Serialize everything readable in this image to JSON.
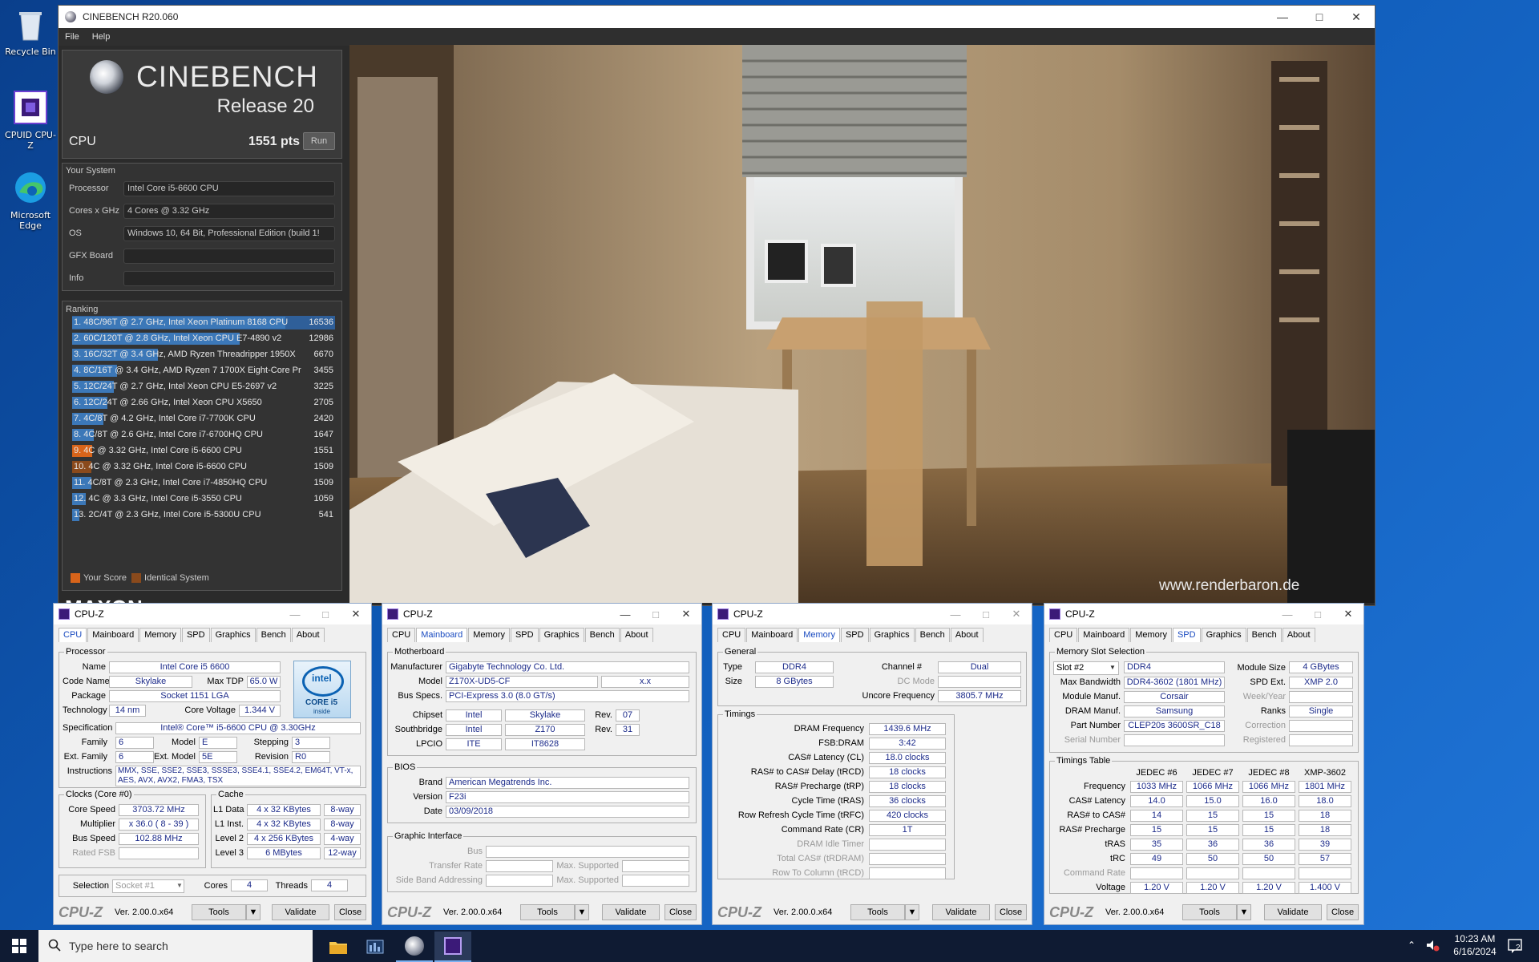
{
  "desktop": {
    "icons": [
      {
        "label": "Recycle Bin"
      },
      {
        "label": "CPUID CPU-Z"
      },
      {
        "label": "Microsoft Edge"
      }
    ]
  },
  "cinebench": {
    "window_title": "CINEBENCH R20.060",
    "menu": [
      "File",
      "Help"
    ],
    "brand": "CINEBENCH",
    "release": "Release 20",
    "cpu_label": "CPU",
    "cpu_score": "1551 pts",
    "run_label": "Run",
    "system_title": "Your System",
    "system": [
      {
        "label": "Processor",
        "value": "Intel Core i5-6600 CPU"
      },
      {
        "label": "Cores x GHz",
        "value": "4 Cores @ 3.32 GHz"
      },
      {
        "label": "OS",
        "value": "Windows 10, 64 Bit, Professional Edition (build 1!"
      },
      {
        "label": "GFX Board",
        "value": ""
      },
      {
        "label": "Info",
        "value": ""
      }
    ],
    "ranking_title": "Ranking",
    "ranking": [
      {
        "text": "1. 48C/96T @ 2.7 GHz, Intel Xeon Platinum 8168 CPU",
        "score": "16536",
        "fraction": 1.0,
        "kind": "other",
        "selected": true
      },
      {
        "text": "2. 60C/120T @ 2.8 GHz, Intel Xeon CPU E7-4890 v2",
        "score": "12986",
        "fraction": 0.785,
        "kind": "other"
      },
      {
        "text": "3. 16C/32T @ 3.4 GHz, AMD Ryzen Threadripper 1950X",
        "score": "6670",
        "fraction": 0.403,
        "kind": "other"
      },
      {
        "text": "4. 8C/16T @ 3.4 GHz, AMD Ryzen 7 1700X Eight-Core Pr",
        "score": "3455",
        "fraction": 0.209,
        "kind": "other"
      },
      {
        "text": "5. 12C/24T @ 2.7 GHz, Intel Xeon CPU E5-2697 v2",
        "score": "3225",
        "fraction": 0.195,
        "kind": "other"
      },
      {
        "text": "6. 12C/24T @ 2.66 GHz, Intel Xeon CPU X5650",
        "score": "2705",
        "fraction": 0.164,
        "kind": "other"
      },
      {
        "text": "7. 4C/8T @ 4.2 GHz, Intel Core i7-7700K CPU",
        "score": "2420",
        "fraction": 0.146,
        "kind": "other"
      },
      {
        "text": "8. 4C/8T @ 2.6 GHz, Intel Core i7-6700HQ CPU",
        "score": "1647",
        "fraction": 0.1,
        "kind": "other"
      },
      {
        "text": "9. 4C @ 3.32 GHz, Intel Core i5-6600 CPU",
        "score": "1551",
        "fraction": 0.094,
        "kind": "yours"
      },
      {
        "text": "10. 4C @ 3.32 GHz, Intel Core i5-6600 CPU",
        "score": "1509",
        "fraction": 0.091,
        "kind": "identical"
      },
      {
        "text": "11. 4C/8T @ 2.3 GHz, Intel Core i7-4850HQ CPU",
        "score": "1509",
        "fraction": 0.091,
        "kind": "other"
      },
      {
        "text": "12. 4C @ 3.3 GHz, Intel Core i5-3550 CPU",
        "score": "1059",
        "fraction": 0.064,
        "kind": "other"
      },
      {
        "text": "13. 2C/4T @ 2.3 GHz, Intel Core i5-5300U CPU",
        "score": "541",
        "fraction": 0.033,
        "kind": "other"
      }
    ],
    "legend": [
      {
        "label": "Your Score",
        "color": "#d8641a"
      },
      {
        "label": "Identical System",
        "color": "#8a4a1c"
      }
    ],
    "maxon_partial": "MAXON",
    "watermark": "www.renderbaron.de"
  },
  "cpuz_common": {
    "title": "CPU-Z",
    "tabs": [
      "CPU",
      "Mainboard",
      "Memory",
      "SPD",
      "Graphics",
      "Bench",
      "About"
    ],
    "logo": "CPU-Z",
    "version": "Ver. 2.00.0.x64",
    "tools": "Tools",
    "validate": "Validate",
    "close": "Close"
  },
  "cpuz_cpu": {
    "processor_group": "Processor",
    "name_label": "Name",
    "name": "Intel Core i5 6600",
    "codename_label": "Code Name",
    "codename": "Skylake",
    "maxtdp_label": "Max TDP",
    "maxtdp": "65.0 W",
    "package_label": "Package",
    "package": "Socket 1151 LGA",
    "tech_label": "Technology",
    "tech": "14 nm",
    "corevolt_label": "Core Voltage",
    "corevolt": "1.344 V",
    "spec_label": "Specification",
    "spec": "Intel® Core™ i5-6600 CPU @ 3.30GHz",
    "family_label": "Family",
    "family": "6",
    "model_label": "Model",
    "model": "E",
    "stepping_label": "Stepping",
    "stepping": "3",
    "extfamily_label": "Ext. Family",
    "extfamily": "6",
    "extmodel_label": "Ext. Model",
    "extmodel": "5E",
    "revision_label": "Revision",
    "revision": "R0",
    "instr_label": "Instructions",
    "instr1": "MMX, SSE, SSE2, SSE3, SSSE3, SSE4.1, SSE4.2, EM64T, VT-x,",
    "instr2": "AES, AVX, AVX2, FMA3, TSX",
    "intel_badge1": "intel",
    "intel_badge2": "CORE i5",
    "intel_badge3": "inside",
    "clocks_group": "Clocks (Core #0)",
    "corespeed_label": "Core Speed",
    "corespeed": "3703.72 MHz",
    "mult_label": "Multiplier",
    "mult": "x 36.0 ( 8 - 39 )",
    "bus_label": "Bus Speed",
    "bus": "102.88 MHz",
    "fsb_label": "Rated FSB",
    "cache_group": "Cache",
    "l1d_label": "L1 Data",
    "l1d": "4 x 32 KBytes",
    "l1d_way": "8-way",
    "l1i_label": "L1 Inst.",
    "l1i": "4 x 32 KBytes",
    "l1i_way": "8-way",
    "l2_label": "Level 2",
    "l2": "4 x 256 KBytes",
    "l2_way": "4-way",
    "l3_label": "Level 3",
    "l3": "6 MBytes",
    "l3_way": "12-way",
    "selection_label": "Selection",
    "selection": "Socket #1",
    "cores_label": "Cores",
    "cores": "4",
    "threads_label": "Threads",
    "threads": "4"
  },
  "cpuz_mb": {
    "mb_group": "Motherboard",
    "manuf_label": "Manufacturer",
    "manuf": "Gigabyte Technology Co. Ltd.",
    "model_label": "Model",
    "model": "Z170X-UD5-CF",
    "model_rev": "x.x",
    "busspec_label": "Bus Specs.",
    "busspec": "PCI-Express 3.0 (8.0 GT/s)",
    "chipset_label": "Chipset",
    "chipset_v": "Intel",
    "chipset_n": "Skylake",
    "chipset_rev_label": "Rev.",
    "chipset_rev": "07",
    "south_label": "Southbridge",
    "south_v": "Intel",
    "south_n": "Z170",
    "south_rev_label": "Rev.",
    "south_rev": "31",
    "lpcio_label": "LPCIO",
    "lpcio_v": "ITE",
    "lpcio_n": "IT8628",
    "bios_group": "BIOS",
    "brand_label": "Brand",
    "brand": "American Megatrends Inc.",
    "version_label": "Version",
    "version": "F23i",
    "date_label": "Date",
    "date": "03/09/2018",
    "gi_group": "Graphic Interface",
    "gi_bus": "Bus",
    "gi_rate": "Transfer Rate",
    "gi_max": "Max. Supported",
    "gi_sba": "Side Band Addressing",
    "gi_max2": "Max. Supported"
  },
  "cpuz_mem": {
    "general_group": "General",
    "type_label": "Type",
    "type": "DDR4",
    "channel_label": "Channel #",
    "channel": "Dual",
    "size_label": "Size",
    "size": "8 GBytes",
    "dcmode_label": "DC Mode",
    "uncore_label": "Uncore Frequency",
    "uncore": "3805.7 MHz",
    "timings_group": "Timings",
    "rows": [
      {
        "label": "DRAM Frequency",
        "value": "1439.6 MHz"
      },
      {
        "label": "FSB:DRAM",
        "value": "3:42"
      },
      {
        "label": "CAS# Latency (CL)",
        "value": "18.0 clocks"
      },
      {
        "label": "RAS# to CAS# Delay (tRCD)",
        "value": "18 clocks"
      },
      {
        "label": "RAS# Precharge (tRP)",
        "value": "18 clocks"
      },
      {
        "label": "Cycle Time (tRAS)",
        "value": "36 clocks"
      },
      {
        "label": "Row Refresh Cycle Time (tRFC)",
        "value": "420 clocks"
      },
      {
        "label": "Command Rate (CR)",
        "value": "1T"
      },
      {
        "label": "DRAM Idle Timer",
        "value": "",
        "dim": true
      },
      {
        "label": "Total CAS# (tRDRAM)",
        "value": "",
        "dim": true
      },
      {
        "label": "Row To Column (tRCD)",
        "value": "",
        "dim": true
      }
    ]
  },
  "cpuz_spd": {
    "slot_group": "Memory Slot Selection",
    "slot": "Slot #2",
    "type": "DDR4",
    "modsize_label": "Module Size",
    "modsize": "4 GBytes",
    "maxbw_label": "Max Bandwidth",
    "maxbw": "DDR4-3602 (1801 MHz)",
    "spdext_label": "SPD Ext.",
    "spdext": "XMP 2.0",
    "modmanuf_label": "Module Manuf.",
    "modmanuf": "Corsair",
    "weekyear_label": "Week/Year",
    "drammanuf_label": "DRAM Manuf.",
    "drammanuf": "Samsung",
    "ranks_label": "Ranks",
    "ranks": "Single",
    "part_label": "Part Number",
    "part": "CLEP20s 3600SR_C18",
    "correction_label": "Correction",
    "serial_label": "Serial Number",
    "registered_label": "Registered",
    "timings_group": "Timings Table",
    "cols": [
      "JEDEC #6",
      "JEDEC #7",
      "JEDEC #8",
      "XMP-3602"
    ],
    "rows": [
      {
        "label": "Frequency",
        "values": [
          "1033 MHz",
          "1066 MHz",
          "1066 MHz",
          "1801 MHz"
        ]
      },
      {
        "label": "CAS# Latency",
        "values": [
          "14.0",
          "15.0",
          "16.0",
          "18.0"
        ]
      },
      {
        "label": "RAS# to CAS#",
        "values": [
          "14",
          "15",
          "15",
          "18"
        ]
      },
      {
        "label": "RAS# Precharge",
        "values": [
          "15",
          "15",
          "15",
          "18"
        ]
      },
      {
        "label": "tRAS",
        "values": [
          "35",
          "36",
          "36",
          "39"
        ]
      },
      {
        "label": "tRC",
        "values": [
          "49",
          "50",
          "50",
          "57"
        ]
      },
      {
        "label": "Command Rate",
        "values": [
          "",
          "",
          "",
          ""
        ],
        "dim": true
      },
      {
        "label": "Voltage",
        "values": [
          "1.20 V",
          "1.20 V",
          "1.20 V",
          "1.400 V"
        ]
      }
    ]
  },
  "taskbar": {
    "search_placeholder": "Type here to search",
    "time": "10:23 AM",
    "date": "6/16/2024",
    "notif_count": "2"
  }
}
